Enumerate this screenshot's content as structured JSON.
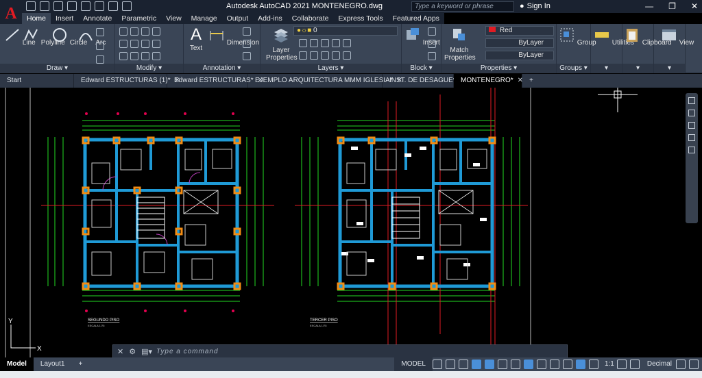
{
  "app": {
    "title": "Autodesk AutoCAD 2021    MONTENEGRO.dwg",
    "logo": "A",
    "search_placeholder": "Type a keyword or phrase",
    "signin": "Sign In"
  },
  "ribbon_tabs": [
    "Home",
    "Insert",
    "Annotate",
    "Parametric",
    "View",
    "Manage",
    "Output",
    "Add-ins",
    "Collaborate",
    "Express Tools",
    "Featured Apps"
  ],
  "active_ribbon_tab": "Home",
  "panels": {
    "draw": {
      "title": "Draw ▾",
      "buttons": [
        "Line",
        "Polyline",
        "Circle",
        "Arc"
      ]
    },
    "modify": {
      "title": "Modify ▾"
    },
    "annotation": {
      "title": "Annotation ▾",
      "buttons": [
        "Text",
        "Dimension"
      ]
    },
    "layers": {
      "title": "Layers ▾",
      "button": "Layer Properties",
      "layer_value": "0"
    },
    "block": {
      "title": "Block ▾",
      "button": "Insert"
    },
    "properties": {
      "title": "Properties ▾",
      "button": "Match Properties",
      "color": "Red",
      "linetype": "ByLayer",
      "lineweight": "ByLayer"
    },
    "groups": {
      "title": "Groups ▾",
      "button": "Group"
    },
    "utilities": {
      "button": "Utilities"
    },
    "clipboard": {
      "button": "Clipboard"
    },
    "view": {
      "button": "View"
    }
  },
  "doc_tabs": [
    {
      "label": "Start",
      "close": false
    },
    {
      "label": "Edward ESTRUCTURAS (1)*",
      "close": true
    },
    {
      "label": "Edward ESTRUCTURAS*",
      "close": true
    },
    {
      "label": "EJEMPLO ARQUITECTURA MMM IGLESIA*",
      "close": true
    },
    {
      "label": "INST. DE DESAGUE*",
      "close": true
    },
    {
      "label": "MONTENEGRO*",
      "close": true,
      "active": true
    }
  ],
  "drawing": {
    "plan_left_title": "SEGUNDO PISO",
    "plan_left_scale": "ESCALA 1/75",
    "plan_right_title": "TERCER PISO",
    "plan_right_scale": "ESCALA 1/75",
    "ucs_y": "Y",
    "ucs_x": "X"
  },
  "command": {
    "placeholder": "Type a command"
  },
  "layout_tabs": [
    "Model",
    "Layout1"
  ],
  "status": {
    "space": "MODEL",
    "scale": "1:1",
    "units": "Decimal"
  },
  "colors": {
    "wall": "#1f9ad6",
    "column": "#f28c13",
    "dim": "#22dd22",
    "accent_red": "#e21b23",
    "tag": "#e3004f"
  }
}
